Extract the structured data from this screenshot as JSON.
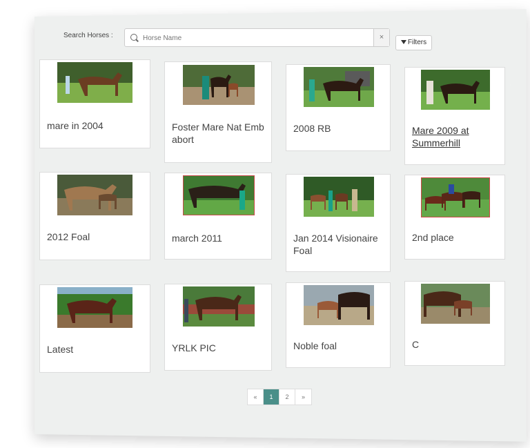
{
  "search": {
    "label": "Search Horses :",
    "placeholder": "Horse Name",
    "clear_icon": "×",
    "filters_label": "Filters"
  },
  "horses": [
    {
      "title": "mare in 2004"
    },
    {
      "title": "Foster Mare Nat Emb abort"
    },
    {
      "title": "2008 RB"
    },
    {
      "title": "Mare 2009 at Summerhill"
    },
    {
      "title": "2012 Foal"
    },
    {
      "title": "march 2011"
    },
    {
      "title": "Jan 2014 Visionaire Foal"
    },
    {
      "title": "2nd place"
    },
    {
      "title": "Latest"
    },
    {
      "title": "YRLK PIC"
    },
    {
      "title": "Noble foal"
    },
    {
      "title": "C"
    }
  ],
  "pagination": {
    "prev": "«",
    "pages": [
      "1",
      "2"
    ],
    "current": "1",
    "next": "»"
  }
}
